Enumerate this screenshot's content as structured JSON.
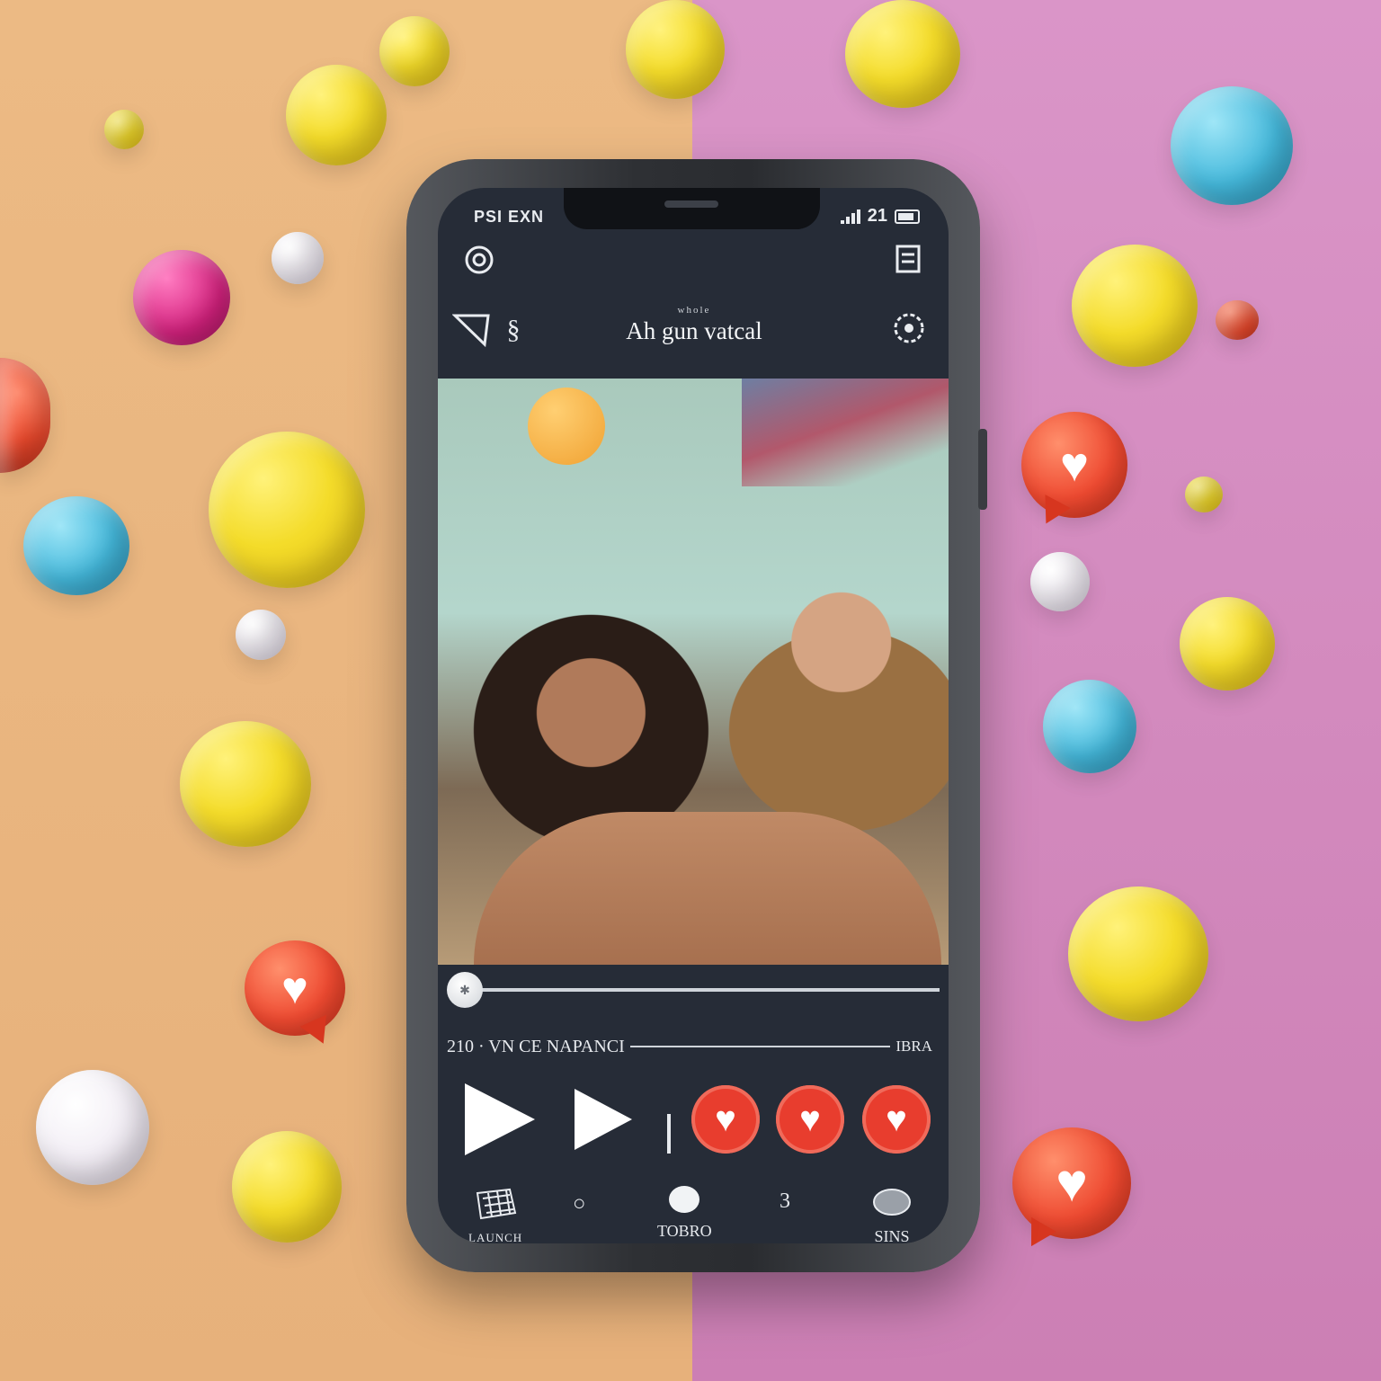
{
  "status_bar": {
    "left_text": "PSI EXN",
    "time": "21"
  },
  "header": {
    "subtitle": "whole",
    "title": "Ah gun vatcal"
  },
  "player": {
    "track_label": "210 · VN CE NAPANCI",
    "track_right_label": "IBRA",
    "progress": 0.0
  },
  "bottom_nav": {
    "items": [
      {
        "label": "LAUNCH",
        "icon": "grid-icon"
      },
      {
        "label": "",
        "icon": "circle-icon"
      },
      {
        "label": "TOBRO",
        "icon": "record-icon"
      },
      {
        "label": "",
        "icon": "number-icon",
        "glyph": "3"
      },
      {
        "label": "SINS",
        "icon": "chat-icon"
      }
    ]
  },
  "colors": {
    "bg_left": "#ecba84",
    "bg_right": "#da95c8",
    "screen": "#262c37",
    "accent_like": "#e83d2e"
  }
}
